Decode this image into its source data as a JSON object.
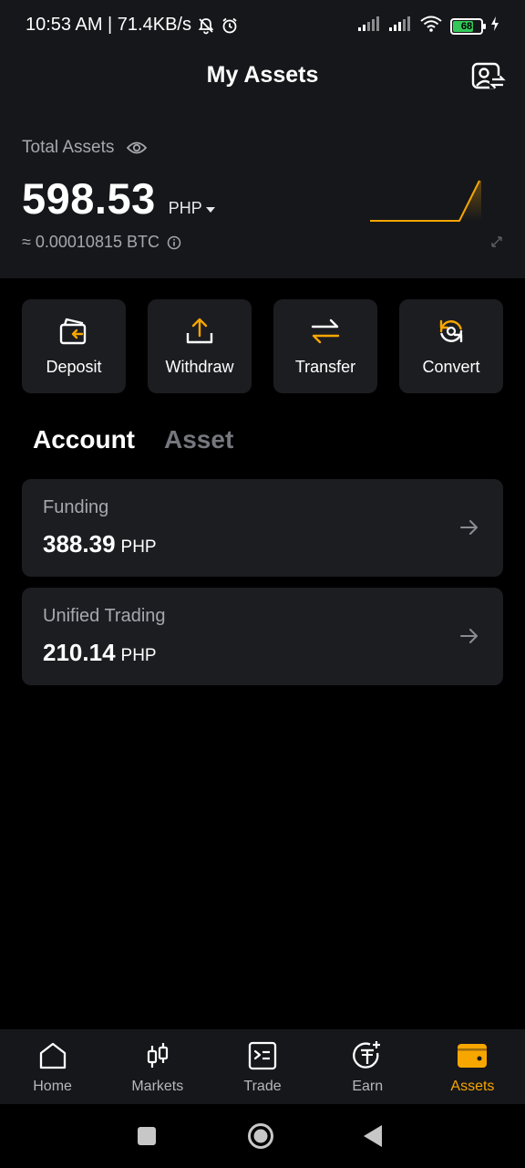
{
  "status_bar": {
    "time_and_speed": "10:53 AM | 71.4KB/s",
    "battery_level": "68"
  },
  "header": {
    "title": "My Assets"
  },
  "total": {
    "label": "Total Assets",
    "amount": "598.53",
    "currency": "PHP",
    "btc_equivalent": "≈ 0.00010815 BTC",
    "accent_color": "#f7a600"
  },
  "actions": [
    {
      "label": "Deposit",
      "icon": "deposit-icon"
    },
    {
      "label": "Withdraw",
      "icon": "withdraw-icon"
    },
    {
      "label": "Transfer",
      "icon": "transfer-icon"
    },
    {
      "label": "Convert",
      "icon": "convert-icon"
    }
  ],
  "tabs": {
    "account": "Account",
    "asset": "Asset",
    "active": "Account"
  },
  "accounts": [
    {
      "name": "Funding",
      "amount": "388.39",
      "currency": "PHP"
    },
    {
      "name": "Unified Trading",
      "amount": "210.14",
      "currency": "PHP"
    }
  ],
  "bottom_nav": [
    {
      "label": "Home",
      "icon": "home-icon"
    },
    {
      "label": "Markets",
      "icon": "candlestick-icon"
    },
    {
      "label": "Trade",
      "icon": "trade-icon"
    },
    {
      "label": "Earn",
      "icon": "earn-coin-icon"
    },
    {
      "label": "Assets",
      "icon": "wallet-icon",
      "active": true
    }
  ]
}
